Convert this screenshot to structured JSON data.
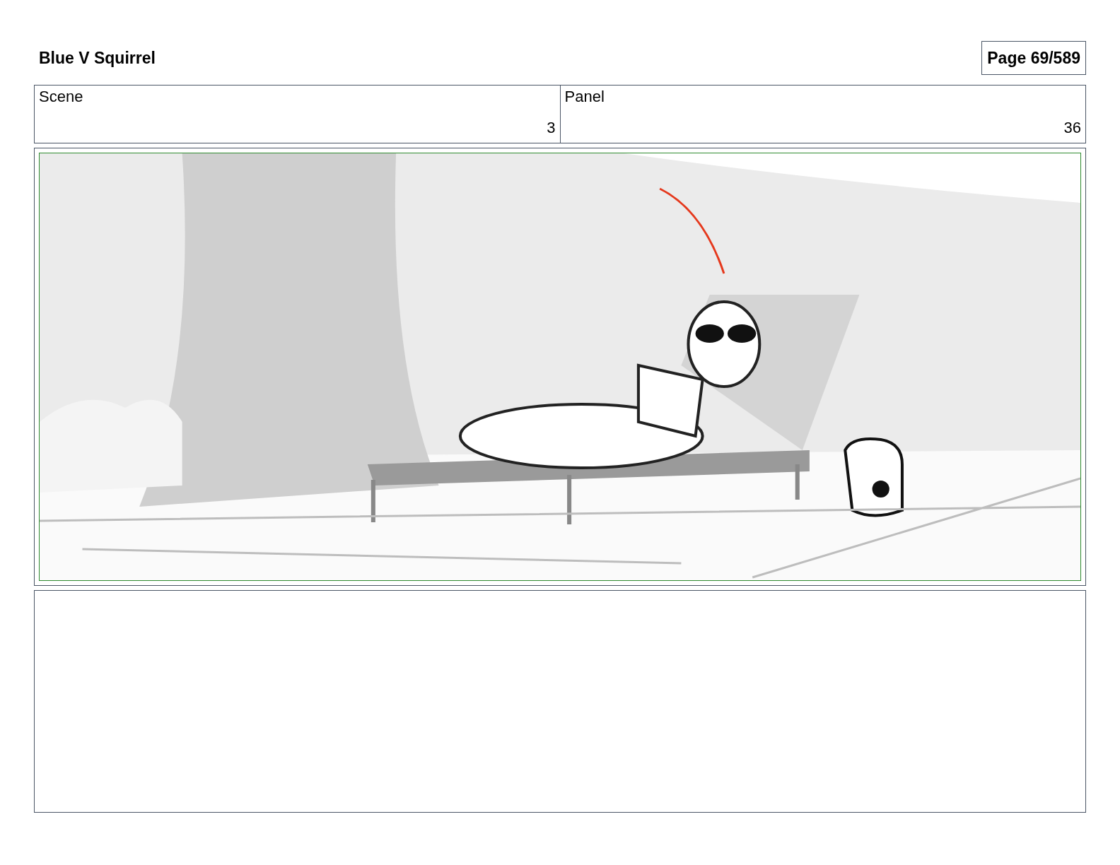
{
  "title": "Blue V Squirrel",
  "page": "Page 69/589",
  "header_cells": [
    {
      "heading": "Scene",
      "number": "3"
    },
    {
      "heading": "Panel",
      "number": "36"
    }
  ]
}
